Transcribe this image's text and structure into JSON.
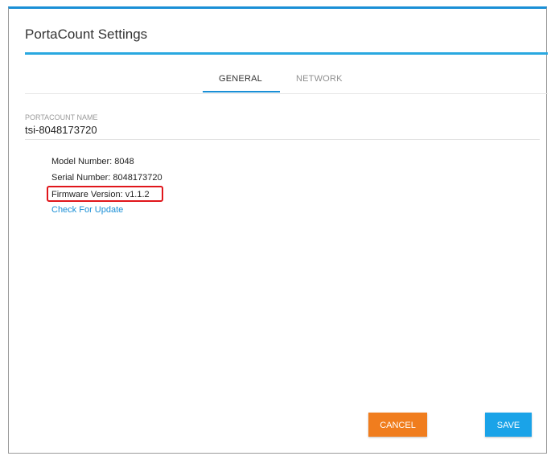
{
  "dialog": {
    "title": "PortaCount Settings"
  },
  "tabs": [
    {
      "label": "GENERAL",
      "active": true
    },
    {
      "label": "NETWORK",
      "active": false
    }
  ],
  "name_field": {
    "label": "PORTACOUNT NAME",
    "value": "tsi-8048173720"
  },
  "info": {
    "model": "Model Number: 8048",
    "serial": "Serial Number: 8048173720",
    "firmware": "Firmware Version: v1.1.2",
    "update_link": "Check For Update"
  },
  "buttons": {
    "cancel": "CANCEL",
    "save": "SAVE"
  },
  "colors": {
    "accent": "#1a8fd6",
    "cancel": "#f07d1e",
    "save": "#1aa3e8",
    "highlight": "#e0161b"
  }
}
